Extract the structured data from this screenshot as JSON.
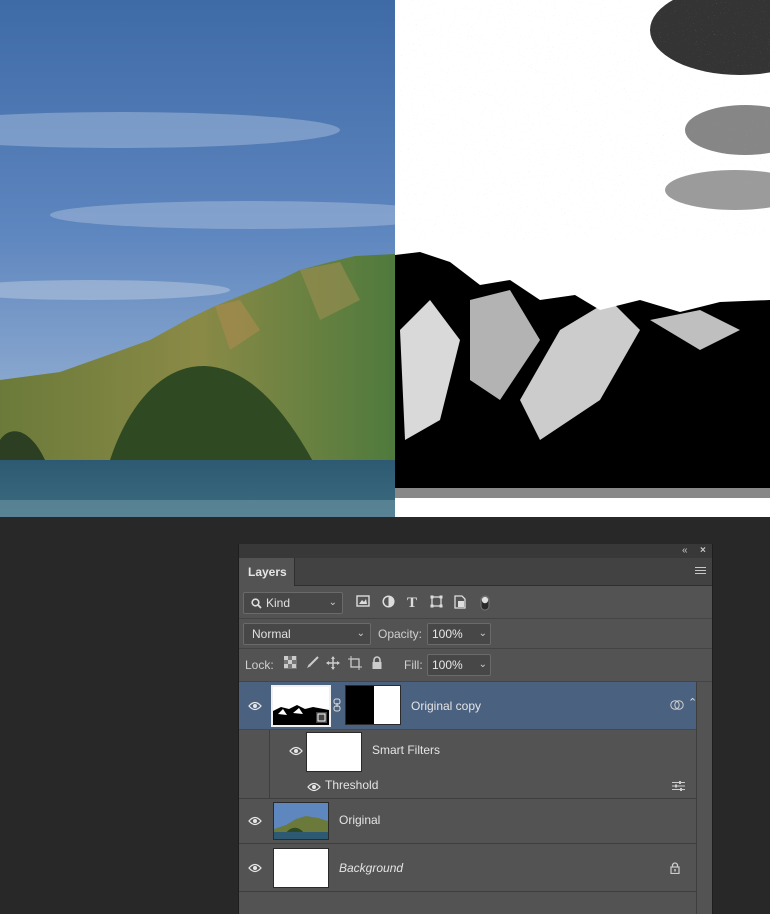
{
  "panel": {
    "collapse_glyph": "«",
    "close_glyph": "×",
    "tab_label": "Layers"
  },
  "filter": {
    "kind_label": "Kind",
    "icons": [
      "pixel-filter-icon",
      "adjustment-filter-icon",
      "type-filter-icon",
      "shape-filter-icon",
      "smart-object-filter-icon",
      "filter-toggle-icon"
    ]
  },
  "blend": {
    "mode": "Normal",
    "opacity_label": "Opacity:",
    "opacity_value": "100%"
  },
  "lock": {
    "label": "Lock:",
    "fill_label": "Fill:",
    "fill_value": "100%"
  },
  "layers": [
    {
      "name": "Original copy",
      "selected": true,
      "type": "smart-object"
    },
    {
      "name": "Smart Filters",
      "type": "smart-filters"
    },
    {
      "name": "Threshold",
      "type": "filter"
    },
    {
      "name": "Original",
      "type": "image"
    },
    {
      "name": "Background",
      "type": "background",
      "locked": true
    }
  ],
  "colors": {
    "selected_row": "#4b6180",
    "panel_bg": "#535353",
    "workspace": "#282828"
  }
}
